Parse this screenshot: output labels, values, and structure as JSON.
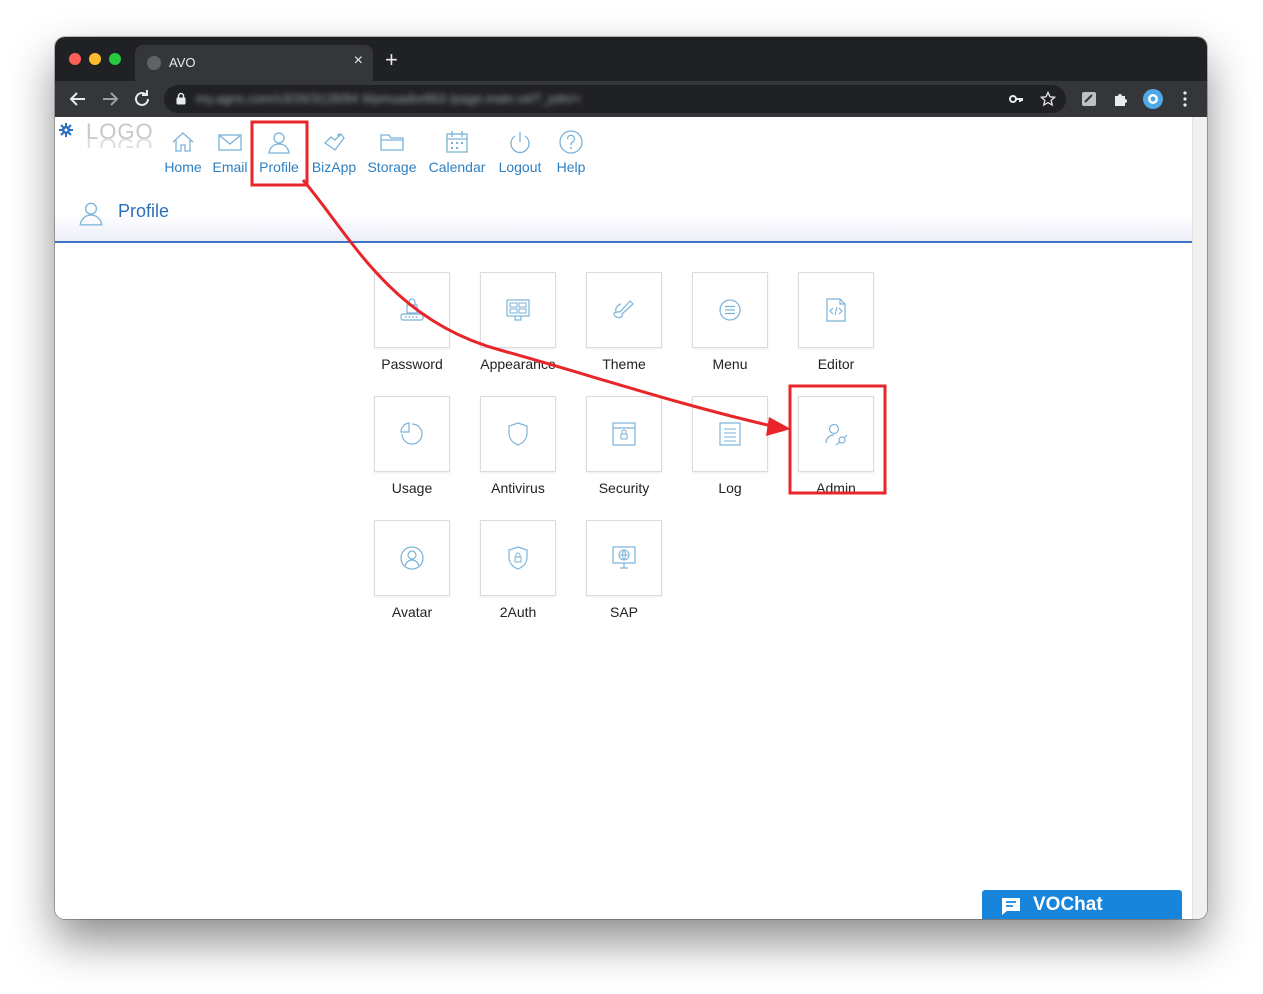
{
  "browser": {
    "tab_title": "AVO",
    "tab_close": "×",
    "new_tab": "+",
    "url": "my.agns.com/v3/26/3128/84 9/pmuador863 /page.main.vel?_pdn/="
  },
  "app": {
    "logo_text": "LOGO",
    "nav": [
      {
        "label": "Home"
      },
      {
        "label": "Email"
      },
      {
        "label": "Profile"
      },
      {
        "label": "BizApp"
      },
      {
        "label": "Storage"
      },
      {
        "label": "Calendar"
      },
      {
        "label": "Logout"
      },
      {
        "label": "Help"
      }
    ],
    "page_title": "Profile",
    "tiles": [
      {
        "label": "Password"
      },
      {
        "label": "Appearance"
      },
      {
        "label": "Theme"
      },
      {
        "label": "Menu"
      },
      {
        "label": "Editor"
      },
      {
        "label": "Usage"
      },
      {
        "label": "Antivirus"
      },
      {
        "label": "Security"
      },
      {
        "label": "Log"
      },
      {
        "label": "Admin"
      },
      {
        "label": "Avatar"
      },
      {
        "label": "2Auth"
      },
      {
        "label": "SAP"
      }
    ],
    "chat_label": "VOChat"
  },
  "colors": {
    "link_blue": "#2d7fc1",
    "icon_blue": "#7ab3d9",
    "highlight_red": "#e8262a",
    "chat_blue": "#1785dc"
  }
}
